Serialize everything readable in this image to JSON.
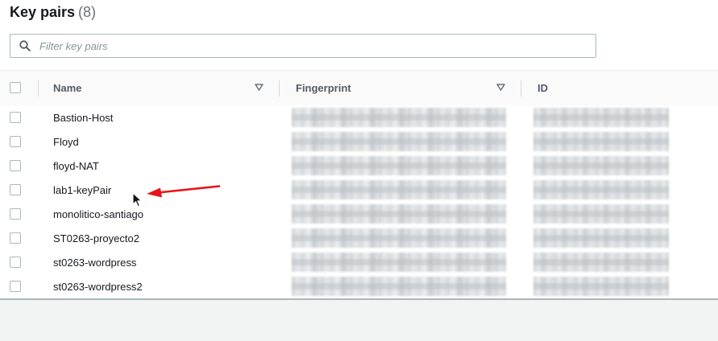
{
  "header": {
    "title": "Key pairs",
    "count": "(8)"
  },
  "search": {
    "placeholder": "Filter key pairs",
    "value": ""
  },
  "table": {
    "columns": [
      "Name",
      "Fingerprint",
      "ID"
    ],
    "rows": [
      {
        "name": "Bastion-Host"
      },
      {
        "name": "Floyd"
      },
      {
        "name": "floyd-NAT"
      },
      {
        "name": "lab1-keyPair"
      },
      {
        "name": "monolitico-santiago"
      },
      {
        "name": "ST0263-proyecto2"
      },
      {
        "name": "st0263-wordpress"
      },
      {
        "name": "st0263-wordpress2"
      }
    ]
  },
  "icons": {
    "search": "search-icon",
    "sort": "sort-caret-icon",
    "cursor": "mouse-pointer-icon",
    "annotation": "red-arrow-icon"
  },
  "colors": {
    "annotation_arrow": "#e8141c",
    "page_background": "#f2f3f3",
    "panel_background": "#ffffff"
  }
}
